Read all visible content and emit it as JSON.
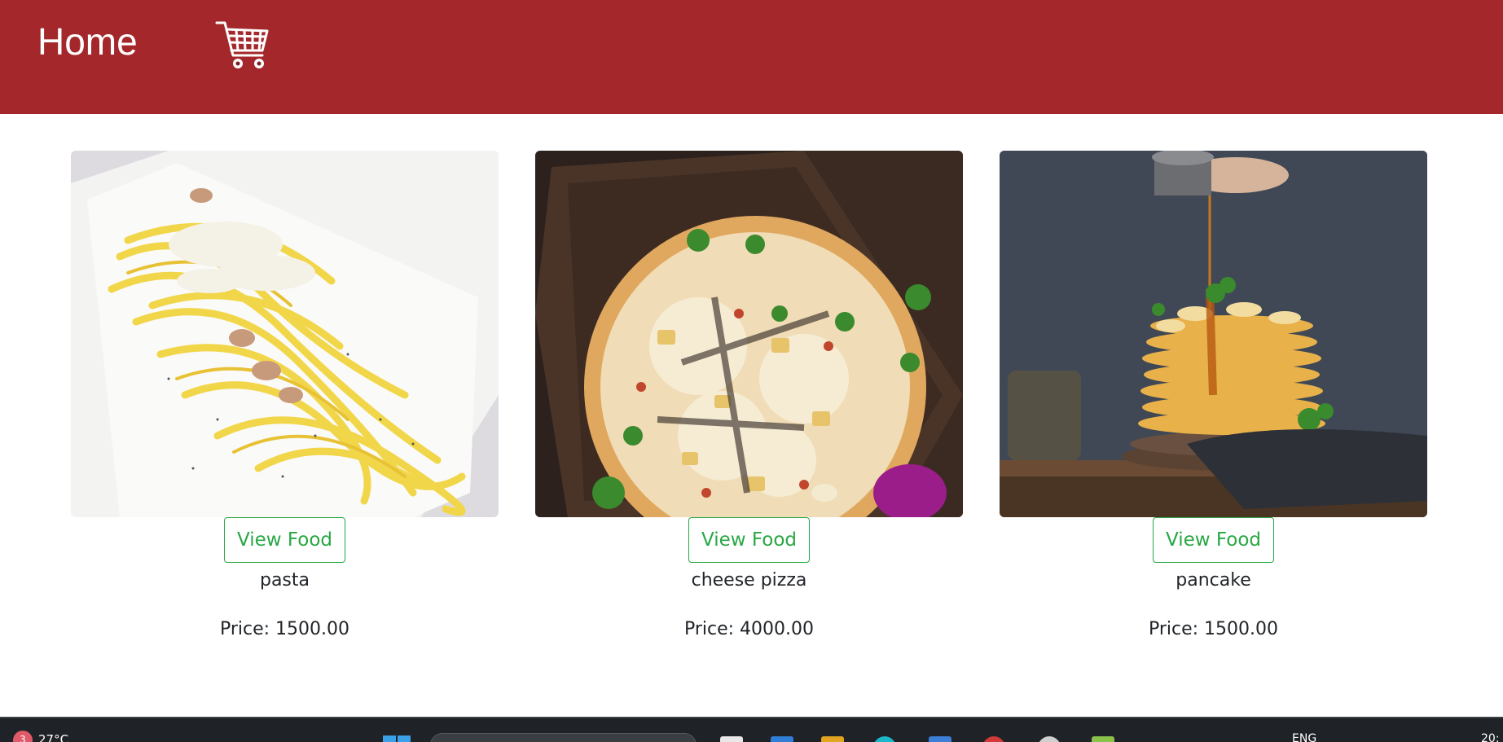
{
  "header": {
    "home_label": "Home",
    "background_color": "#a4282b",
    "cart_icon": "shopping-cart-icon"
  },
  "foods": [
    {
      "name": "pasta",
      "price": "Price: 1500.00",
      "button_label": "View Food",
      "image": "pasta-photo"
    },
    {
      "name": "cheese pizza",
      "price": "Price: 4000.00",
      "button_label": "View Food",
      "image": "pizza-photo"
    },
    {
      "name": "pancake",
      "price": "Price: 1500.00",
      "button_label": "View Food",
      "image": "pancake-photo"
    }
  ],
  "accent_color": "#28a745",
  "taskbar": {
    "weather_badge": "3",
    "weather_temp": "27°C",
    "language": "ENG",
    "clock": "20:"
  }
}
